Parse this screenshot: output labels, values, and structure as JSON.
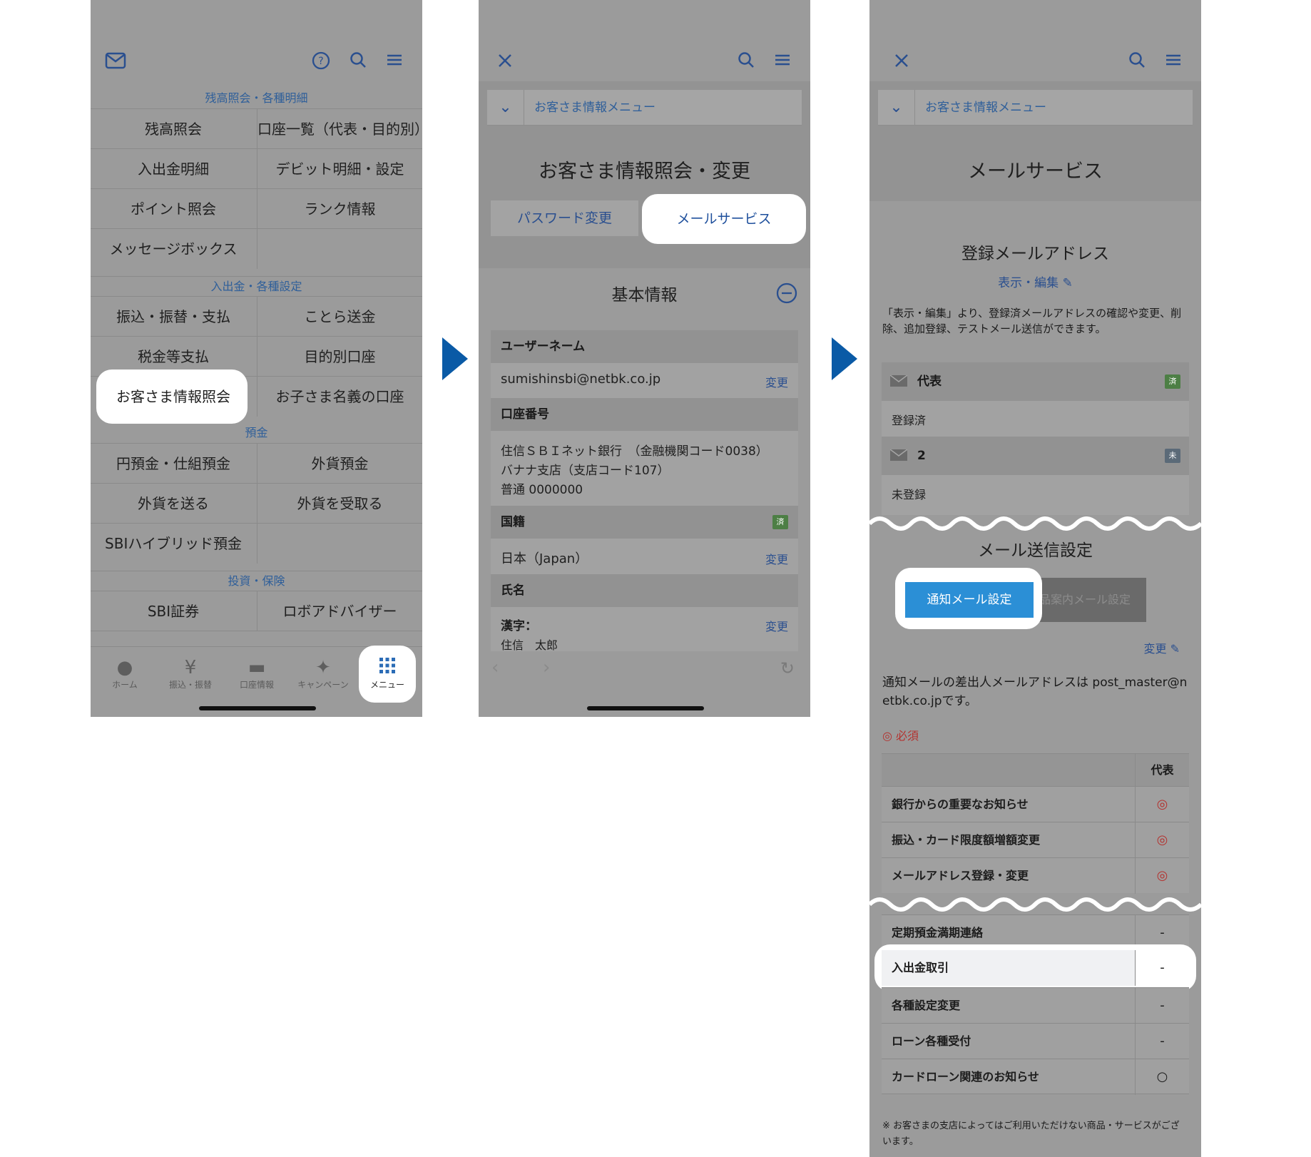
{
  "screen1": {
    "sections": {
      "balance": "残高照会・各種明細",
      "transfer": "入出金・各種設定",
      "deposit": "預金",
      "invest": "投資・保険"
    },
    "rows": [
      [
        "残高照会",
        "口座一覧（代表・目的別）"
      ],
      [
        "入出金明細",
        "デビット明細・設定"
      ],
      [
        "ポイント照会",
        "ランク情報"
      ],
      [
        "メッセージボックス",
        ""
      ],
      [
        "振込・振替・支払",
        "ことら送金"
      ],
      [
        "税金等支払",
        "目的別口座"
      ],
      [
        "お客さま情報照会",
        "お子さま名義の口座"
      ],
      [
        "円預金・仕組預金",
        "外貨預金"
      ],
      [
        "外貨を送る",
        "外貨を受取る"
      ],
      [
        "SBIハイブリッド預金",
        ""
      ],
      [
        "SBI証券",
        "ロボアドバイザー"
      ]
    ],
    "tabs": [
      "ホーム",
      "振込・振替",
      "口座情報",
      "キャンペーン",
      "メニュー"
    ]
  },
  "screen2": {
    "crumb": "お客さま情報メニュー",
    "title": "お客さま情報照会・変更",
    "tab_password": "パスワード変更",
    "tab_mail": "メールサービス",
    "section_title": "基本情報",
    "username_label": "ユーザーネーム",
    "username_value": "sumishinsbi@netbk.co.jp",
    "change": "変更",
    "account_label": "口座番号",
    "account_line1": "住信ＳＢＩネット銀行　（金融機関コード0038）",
    "account_line2": "バナナ支店（支店コード107）",
    "account_line3": "普通 0000000",
    "nationality_label": "国籍",
    "nationality_value": "日本（Japan）",
    "badge_done": "済",
    "name_label": "氏名",
    "kanji_label": "漢字：",
    "kanji_value": "住信　太郎"
  },
  "screen3": {
    "crumb": "お客さま情報メニュー",
    "title": "メールサービス",
    "registered_title": "登録メールアドレス",
    "view_edit": "表示・編集",
    "desc": "「表示・編集」より、登録済メールアドレスの確認や変更、削除、追加登録、テストメール送信ができます。",
    "addr1_label": "代表",
    "addr1_badge": "済",
    "addr1_status": "登録済",
    "addr2_label": "2",
    "addr2_badge": "未",
    "addr2_status": "未登録",
    "send_title": "メール送信設定",
    "btn_notify": "通知メール設定",
    "btn_product": "商品案内メール設定",
    "change": "変更",
    "sender_note": "通知メールの差出人メールアドレスは post_master@netbk.co.jpです。",
    "required": "◎ 必須",
    "col_header": "代表",
    "rows_a": [
      {
        "label": "銀行からの重要なお知らせ",
        "value": "◎"
      },
      {
        "label": "振込・カード限度額増額変更",
        "value": "◎"
      },
      {
        "label": "メールアドレス登録・変更",
        "value": "◎"
      }
    ],
    "rows_b": [
      {
        "label": "定期預金満期連絡",
        "value": "-"
      },
      {
        "label": "入出金取引",
        "value": "-"
      },
      {
        "label": "各種設定変更",
        "value": "-"
      },
      {
        "label": "ローン各種受付",
        "value": "-"
      },
      {
        "label": "カードローン関連のお知らせ",
        "value": "○"
      }
    ],
    "footnote": "※ お客さまの支店によってはご利用いただけない商品・サービスがございます。"
  },
  "colors": {
    "accent": "#0a5aa6",
    "link": "#2a4f8f",
    "required": "#b4322f",
    "button": "#2b8fd6"
  }
}
